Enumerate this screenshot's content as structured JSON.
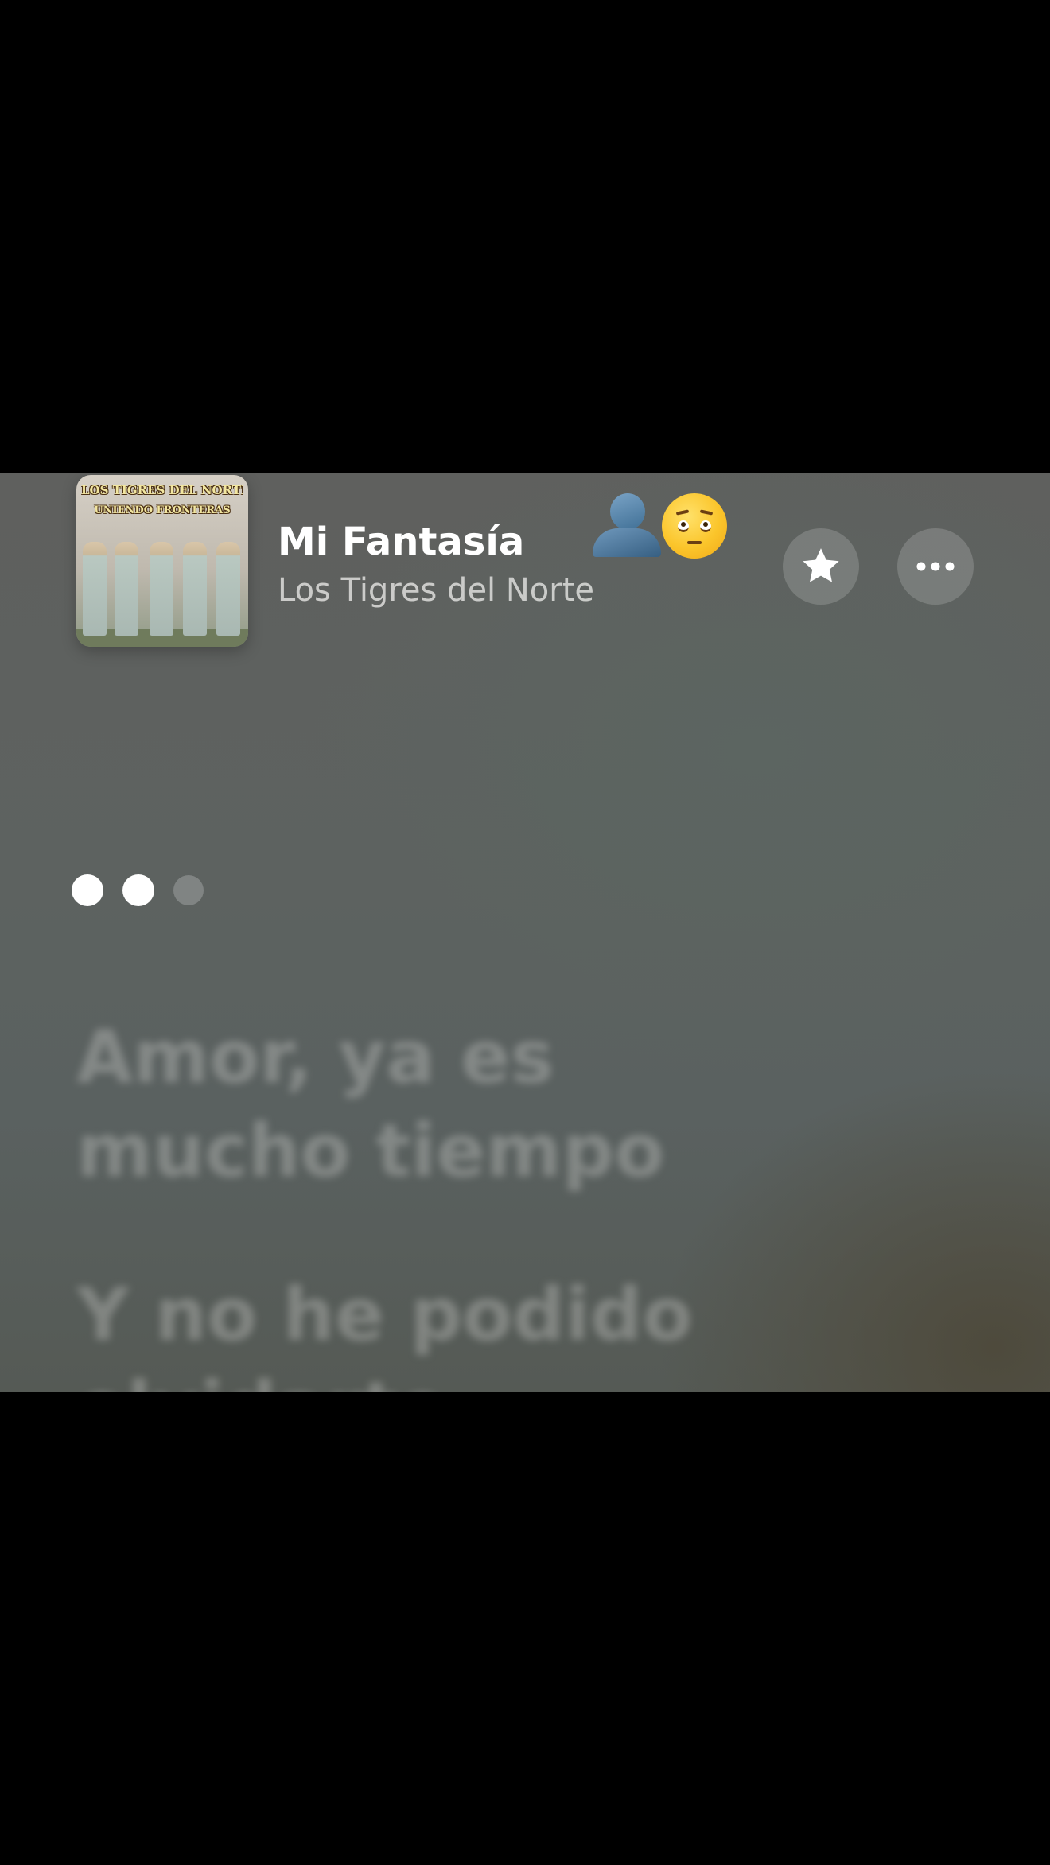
{
  "now_playing": {
    "title": "Mi Fantasía",
    "artist": "Los Tigres del Norte",
    "artwork": {
      "banner_line_1": "LOS TIGRES DEL NORTE",
      "banner_line_2": "UNIENDO FRONTERAS"
    }
  },
  "stickers": [
    "bust-in-silhouette-icon",
    "pleading-face-icon"
  ],
  "controls": {
    "favorite_icon": "star-icon",
    "more_icon": "ellipsis-icon"
  },
  "lyrics": {
    "interlude_dots": [
      true,
      true,
      false
    ],
    "lines": [
      "Amor, ya es",
      "mucho tiempo",
      "Y no he podido",
      "olvidarte"
    ]
  },
  "colors": {
    "background": "#5d6260",
    "accent_text": "#ffffff",
    "button_fill": "rgba(255,255,255,0.17)"
  }
}
